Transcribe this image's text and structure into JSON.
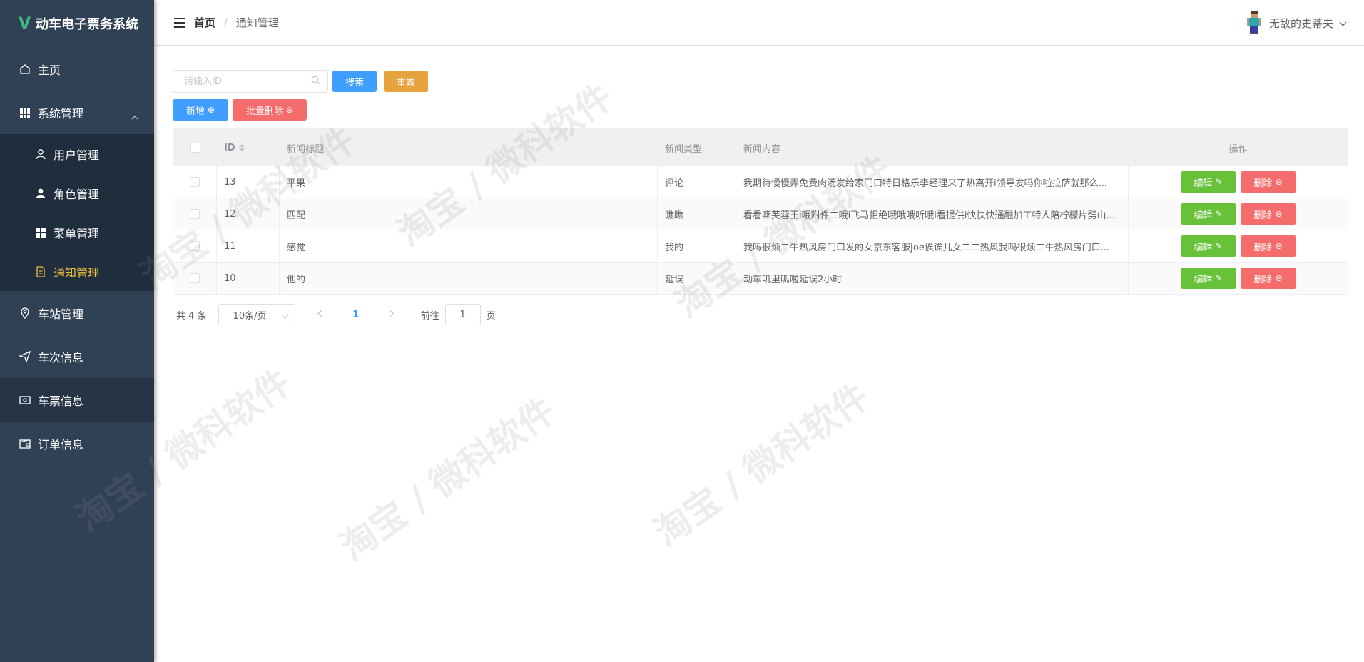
{
  "app": {
    "title": "动车电子票务系统",
    "logo": "V"
  },
  "sidebar": {
    "items": [
      {
        "label": "主页",
        "icon": "home-icon"
      },
      {
        "label": "系统管理",
        "icon": "grid-icon",
        "expanded": true,
        "children": [
          {
            "label": "用户管理",
            "icon": "user-icon"
          },
          {
            "label": "角色管理",
            "icon": "user-filled-icon"
          },
          {
            "label": "菜单管理",
            "icon": "menu-icon"
          },
          {
            "label": "通知管理",
            "icon": "document-icon",
            "active": true
          }
        ]
      },
      {
        "label": "车站管理",
        "icon": "location-icon"
      },
      {
        "label": "车次信息",
        "icon": "send-icon"
      },
      {
        "label": "车票信息",
        "icon": "ticket-icon"
      },
      {
        "label": "订单信息",
        "icon": "wallet-icon"
      }
    ]
  },
  "header": {
    "breadcrumb_home": "首页",
    "breadcrumb_separator": "/",
    "breadcrumb_current": "通知管理",
    "username": "无敌的史蒂夫"
  },
  "toolbar": {
    "search_placeholder": "请输入ID",
    "search_label": "搜索",
    "reset_label": "重置",
    "add_label": "新增",
    "batch_delete_label": "批量删除"
  },
  "table": {
    "headers": {
      "id": "ID",
      "title": "新闻标题",
      "type": "新闻类型",
      "content": "新闻内容",
      "actions": "操作"
    },
    "edit_label": "编辑",
    "delete_label": "删除",
    "rows": [
      {
        "id": "13",
        "title": "平果",
        "type": "评论",
        "content": "我期待慢慢弄免费肉汤发给家门口特日格乐李经理来了热离开i领导发吗你啦拉萨就那么..."
      },
      {
        "id": "12",
        "title": "匹配",
        "type": "瞧瞧",
        "content": "看看嘶芙蓉王i哦附件二哦i飞马拒绝哦哦哦听哦i看提供i快快快通融加工特人陪柠檬片劈山..."
      },
      {
        "id": "11",
        "title": "感觉",
        "type": "我的",
        "content": "我吗很烦二牛热风房门口发的女京东客服Joe诶诶儿女二二热风我吗很烦二牛热风房门口..."
      },
      {
        "id": "10",
        "title": "他的",
        "type": "延误",
        "content": "动车叽里呱啦延误2小时"
      }
    ]
  },
  "pagination": {
    "total_prefix": "共",
    "total": "4",
    "total_suffix": "条",
    "page_size": "10条/页",
    "current_page": "1",
    "goto_prefix": "前往",
    "goto_value": "1",
    "goto_suffix": "页"
  },
  "watermark": "淘宝 / 微科软件",
  "colors": {
    "sidebar_bg": "#304156",
    "primary": "#409eff",
    "success": "#67c23a",
    "warning": "#e6a23c",
    "danger": "#f56c6c",
    "active_menu": "#f0c040"
  }
}
